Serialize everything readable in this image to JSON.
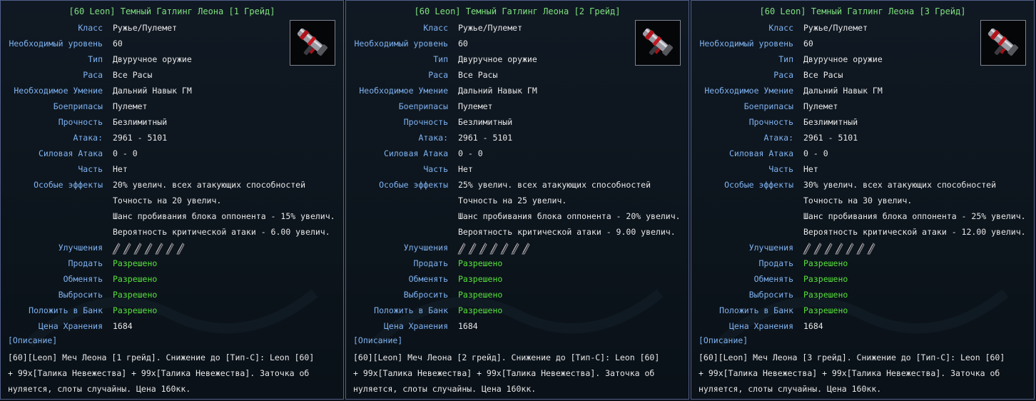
{
  "labels": {
    "class": "Класс",
    "level": "Необходимый уровень",
    "type": "Тип",
    "race": "Раса",
    "skill": "Необходимое Умение",
    "ammo": "Боеприпасы",
    "durability": "Прочность",
    "attack": "Атака:",
    "power_attack": "Силовая Атака",
    "part": "Часть",
    "effects": "Особые эффекты",
    "upgrades": "Улучшения",
    "sell": "Продать",
    "trade": "Обменять",
    "drop": "Выбросить",
    "bank": "Положить в Банк",
    "storage_price": "Цена Хранения",
    "description": "[Описание]"
  },
  "panels": [
    {
      "title": "[60 Leon] Темный Гатлинг Леона [1 Грейд]",
      "class": "Ружье/Пулемет",
      "level": "60",
      "type": "Двуручное оружие",
      "race": "Все Расы",
      "skill": "Дальний Навык ГМ",
      "ammo": "Пулемет",
      "durability": "Безлимитный",
      "attack": "2961 - 5101",
      "power_attack": "0 - 0",
      "part": "Нет",
      "effects": [
        "20% увелич. всех атакующих способностей",
        "Точность на 20 увелич.",
        "Шанс пробивания блока оппонента - 15% увелич.",
        "Вероятность критической атаки - 6.00 увелич."
      ],
      "sell": "Разрешено",
      "trade": "Разрешено",
      "drop": "Разрешено",
      "bank": "Разрешено",
      "storage_price": "1684",
      "description": "[60][Leon] Меч Леона [1 грейд]. Снижение до [Тип-C]: Leon [60]\n + 99x[Талика Невежества] + 99x[Талика Невежества]. Заточка об\nнуляется, слоты случайны. Цена 160кк."
    },
    {
      "title": "[60 Leon] Темный Гатлинг Леона [2 Грейд]",
      "class": "Ружье/Пулемет",
      "level": "60",
      "type": "Двуручное оружие",
      "race": "Все Расы",
      "skill": "Дальний Навык ГМ",
      "ammo": "Пулемет",
      "durability": "Безлимитный",
      "attack": "2961 - 5101",
      "power_attack": "0 - 0",
      "part": "Нет",
      "effects": [
        "25% увелич. всех атакующих способностей",
        "Точность на 25 увелич.",
        "Шанс пробивания блока оппонента - 20% увелич.",
        "Вероятность критической атаки - 9.00 увелич."
      ],
      "sell": "Разрешено",
      "trade": "Разрешено",
      "drop": "Разрешено",
      "bank": "Разрешено",
      "storage_price": "1684",
      "description": "[60][Leon] Меч Леона [2 грейд]. Снижение до [Тип-C]: Leon [60]\n + 99x[Талика Невежества] + 99x[Талика Невежества]. Заточка об\nнуляется, слоты случайны. Цена 160кк."
    },
    {
      "title": "[60 Leon] Темный Гатлинг Леона [3 Грейд]",
      "class": "Ружье/Пулемет",
      "level": "60",
      "type": "Двуручное оружие",
      "race": "Все Расы",
      "skill": "Дальний Навык ГМ",
      "ammo": "Пулемет",
      "durability": "Безлимитный",
      "attack": "2961 - 5101",
      "power_attack": "0 - 0",
      "part": "Нет",
      "effects": [
        "30% увелич. всех атакующих способностей",
        "Точность на 30 увелич.",
        "Шанс пробивания блока оппонента - 25% увелич.",
        "Вероятность критической атаки - 12.00 увелич."
      ],
      "sell": "Разрешено",
      "trade": "Разрешено",
      "drop": "Разрешено",
      "bank": "Разрешено",
      "storage_price": "1684",
      "description": "[60][Leon] Меч Леона [3 грейд]. Снижение до [Тип-C]: Leon [60]\n + 99x[Талика Невежества] + 99x[Талика Невежества]. Заточка об\nнуляется, слоты случайны. Цена 160кк."
    }
  ],
  "icons": {
    "weapon": "gatling-gun-icon",
    "upgrade_slot": "empty-talic-slot-icon"
  },
  "colors": {
    "label": "#7fb3f2",
    "value": "#e7e7e7",
    "title": "#7fe07f",
    "allowed": "#58e23c",
    "border": "#53608a"
  }
}
